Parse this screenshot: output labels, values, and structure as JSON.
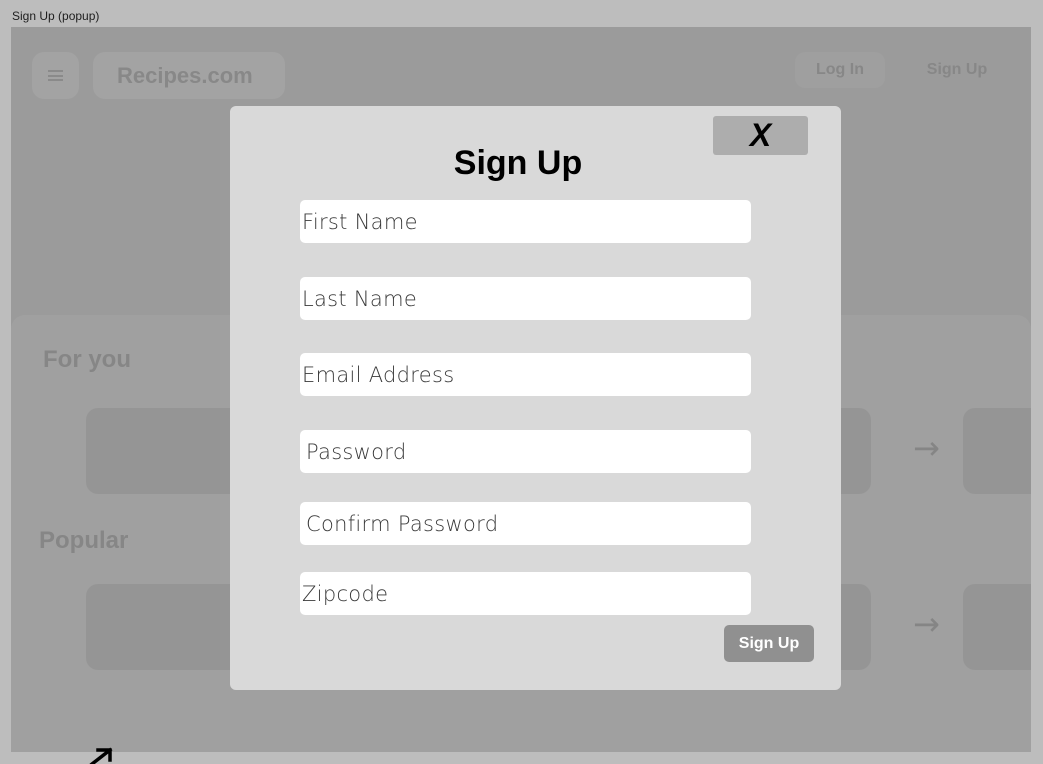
{
  "frame_label": "Sign Up (popup)",
  "header": {
    "brand": "Recipes.com",
    "login_label": "Log In",
    "signup_label": "Sign Up",
    "menu_icon": "hamburger-menu-icon"
  },
  "sections": {
    "for_you_title": "For you",
    "popular_title": "Popular",
    "arrow_glyph": "→"
  },
  "modal": {
    "title": "Sign Up",
    "close_label": "X",
    "fields": {
      "first_name": "First Name",
      "last_name": "Last Name",
      "email": "Email Address",
      "password": "Password",
      "confirm_password": "Confirm Password",
      "zipcode": "Zipcode"
    },
    "submit_label": "Sign Up"
  },
  "colors": {
    "overlay": "#9b9b9b",
    "modal_bg": "#d9d9d9",
    "submit_bg": "#909090",
    "close_bg": "#adadad"
  }
}
